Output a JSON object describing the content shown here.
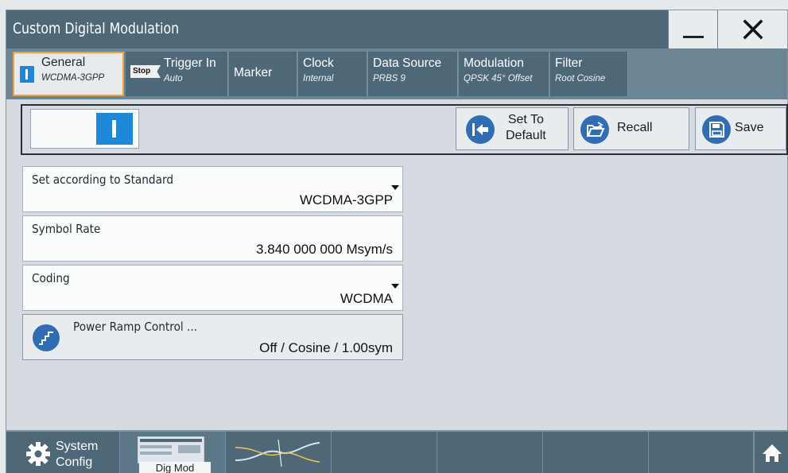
{
  "window": {
    "title": "Custom Digital Modulation"
  },
  "tabs": [
    {
      "label": "General",
      "sub": "WCDMA-3GPP"
    },
    {
      "badge": "Stop",
      "label": "Trigger In",
      "sub": "Auto"
    },
    {
      "label": "Marker",
      "sub": ""
    },
    {
      "label": "Clock",
      "sub": "Internal"
    },
    {
      "label": "Data Source",
      "sub": "PRBS 9"
    },
    {
      "label": "Modulation",
      "sub": "QPSK 45° Offset"
    },
    {
      "label": "Filter",
      "sub": "Root Cosine"
    }
  ],
  "toolbar": {
    "state_toggle": "on",
    "set_default_line1": "Set To",
    "set_default_line2": "Default",
    "recall_label": "Recall",
    "save_label": "Save"
  },
  "fields": {
    "standard": {
      "label": "Set according to Standard",
      "value": "WCDMA-3GPP"
    },
    "symbol_rate": {
      "label": "Symbol Rate",
      "value": "3.840 000 000 Msym/s"
    },
    "coding": {
      "label": "Coding",
      "value": "WCDMA"
    },
    "power_ramp": {
      "label": "Power Ramp Control ...",
      "value": "Off / Cosine / 1.00sym"
    }
  },
  "taskbar": {
    "system_config_line1": "System",
    "system_config_line2": "Config",
    "dig_mod_label": "Dig Mod"
  },
  "colors": {
    "title_bar": "#4e6878",
    "accent_blue": "#1e87d8",
    "active_tab_border": "#f2a03a",
    "icon_blue": "#2f6db5"
  }
}
